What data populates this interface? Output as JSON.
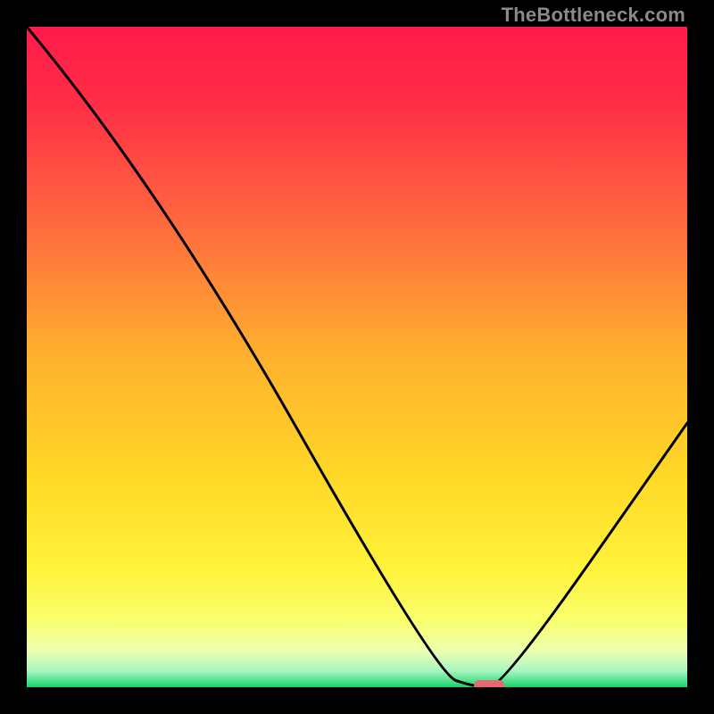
{
  "watermark": "TheBottleneck.com",
  "chart_data": {
    "type": "line",
    "title": "",
    "xlabel": "",
    "ylabel": "",
    "xlim": [
      0,
      100
    ],
    "ylim": [
      0,
      100
    ],
    "x": [
      0,
      20,
      62,
      68,
      72,
      100
    ],
    "values": [
      100,
      76,
      2,
      0,
      0,
      40
    ],
    "marker": {
      "x": 70,
      "y": 0,
      "color": "#e46a6f"
    },
    "gradient_stops": [
      {
        "pos": 0.0,
        "color": "#ff1a49"
      },
      {
        "pos": 0.12,
        "color": "#ff2f46"
      },
      {
        "pos": 0.3,
        "color": "#ff6a3f"
      },
      {
        "pos": 0.5,
        "color": "#ffb12e"
      },
      {
        "pos": 0.68,
        "color": "#ffd827"
      },
      {
        "pos": 0.82,
        "color": "#fff23a"
      },
      {
        "pos": 0.9,
        "color": "#faff6e"
      },
      {
        "pos": 0.945,
        "color": "#ecffb0"
      },
      {
        "pos": 0.975,
        "color": "#a8f7c1"
      },
      {
        "pos": 1.0,
        "color": "#17d36b"
      }
    ]
  }
}
